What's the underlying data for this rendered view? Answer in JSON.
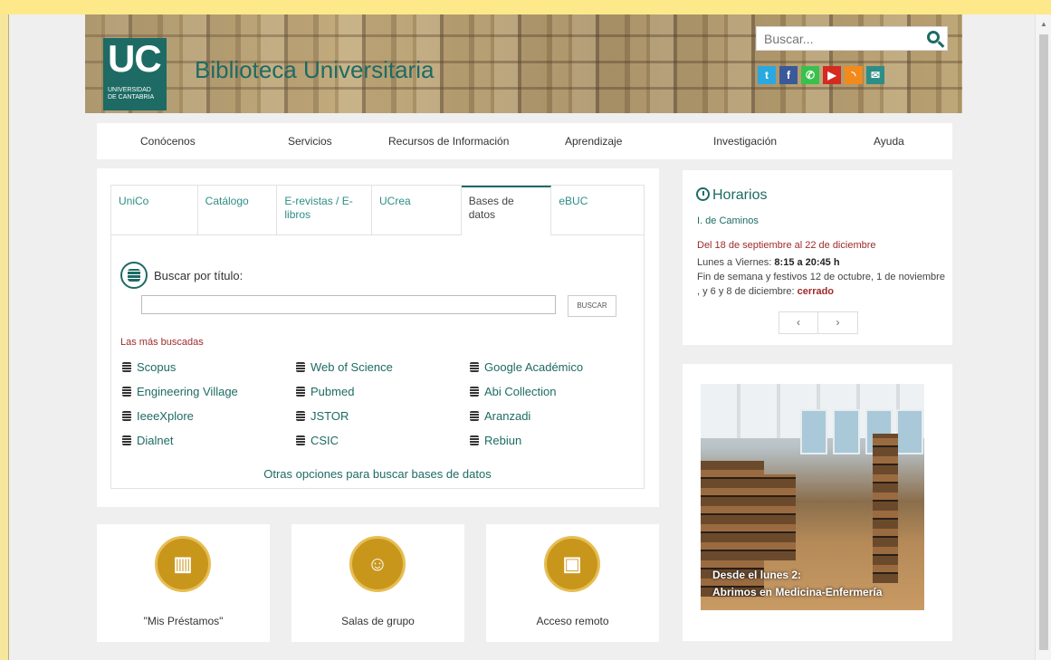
{
  "header": {
    "logo_text": "UC",
    "logo_subtext_1": "UNIVERSIDAD",
    "logo_subtext_2": "DE CANTABRIA",
    "title": "Biblioteca Universitaria",
    "search_placeholder": "Buscar...",
    "social": [
      "twitter-icon",
      "facebook-icon",
      "whatsapp-icon",
      "youtube-icon",
      "rss-icon",
      "mail-icon"
    ]
  },
  "nav": [
    "Conócenos",
    "Servicios",
    "Recursos de Información",
    "Aprendizaje",
    "Investigación",
    "Ayuda"
  ],
  "search_panel": {
    "tabs": [
      "UniCo",
      "Catálogo",
      "E-revistas / E-libros",
      "UCrea",
      "Bases de datos",
      "eBUC"
    ],
    "active_tab": "Bases de datos",
    "search_label": "Buscar por título:",
    "search_button": "BUSCAR",
    "most_searched_label": "Las más buscadas",
    "databases": [
      "Scopus",
      "Web of Science",
      "Google Académico",
      "Engineering Village",
      "Pubmed",
      "Abi Collection",
      "IeeeXplore",
      "JSTOR",
      "Aranzadi",
      "Dialnet",
      "CSIC",
      "Rebiun"
    ],
    "other_options": "Otras opciones para buscar bases de datos"
  },
  "horarios": {
    "title": "Horarios",
    "location": "I. de Caminos",
    "dates": "Del 18 de septiembre al 22 de diciembre",
    "weekday_label": "Lunes a Viernes:",
    "weekday_hours": "8:15 a 20:45 h",
    "weekend_text": "Fin de semana y festivos 12 de octubre, 1 de noviembre , y 6 y 8 de diciembre:",
    "weekend_status": "cerrado",
    "prev": "‹",
    "next": "›"
  },
  "news": {
    "caption_line1": "Desde el lunes 2:",
    "caption_line2": "Abrimos en Medicina-Enfermería"
  },
  "cards": [
    {
      "label": "\"Mis Préstamos\"",
      "icon": "books-icon"
    },
    {
      "label": "Salas de grupo",
      "icon": "group-icon"
    },
    {
      "label": "Acceso remoto",
      "icon": "remote-access-icon"
    }
  ],
  "colors": {
    "brand": "#1d6b64",
    "accent_red": "#9e2a2b",
    "gold": "#c9961c"
  }
}
